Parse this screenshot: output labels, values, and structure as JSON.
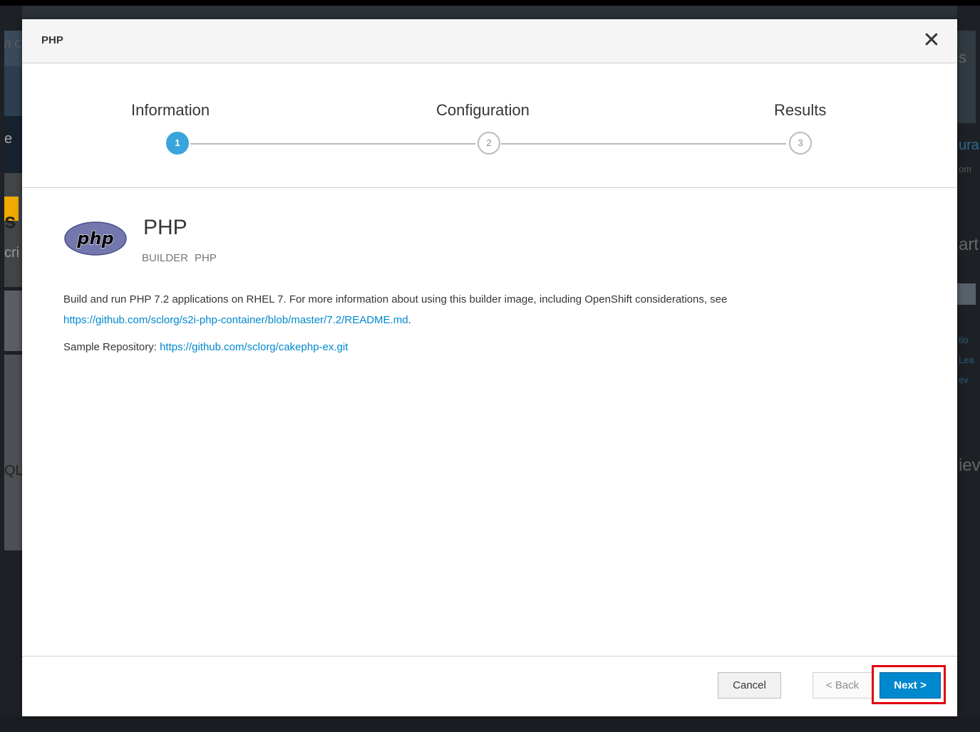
{
  "background": {
    "left_fragments": [
      "h C",
      "e",
      "s",
      "cri",
      "QL"
    ],
    "right_fragments": [
      "s",
      "ura",
      "om",
      "art",
      "tio",
      "Lea",
      "ev",
      "iev"
    ]
  },
  "modal": {
    "title": "PHP",
    "close_glyph": "✕"
  },
  "wizard": {
    "steps": [
      {
        "label": "Information",
        "number": "1",
        "state": "active"
      },
      {
        "label": "Configuration",
        "number": "2",
        "state": "inactive"
      },
      {
        "label": "Results",
        "number": "3",
        "state": "inactive"
      }
    ]
  },
  "item": {
    "logo_text": "php",
    "title": "PHP",
    "tags": [
      "BUILDER",
      "PHP"
    ],
    "description": "Build and run PHP 7.2 applications on RHEL 7. For more information about using this builder image, including OpenShift considerations, see",
    "description_link": "https://github.com/sclorg/s2i-php-container/blob/master/7.2/README.md",
    "description_end": ".",
    "sample_label": "Sample Repository:",
    "sample_link": "https://github.com/sclorg/cakephp-ex.git"
  },
  "footer": {
    "cancel_label": "Cancel",
    "back_label": "< Back",
    "next_label": "Next >"
  },
  "colors": {
    "accent": "#39a5dc",
    "primary_button": "#0088ce",
    "highlight": "#e0000d"
  }
}
